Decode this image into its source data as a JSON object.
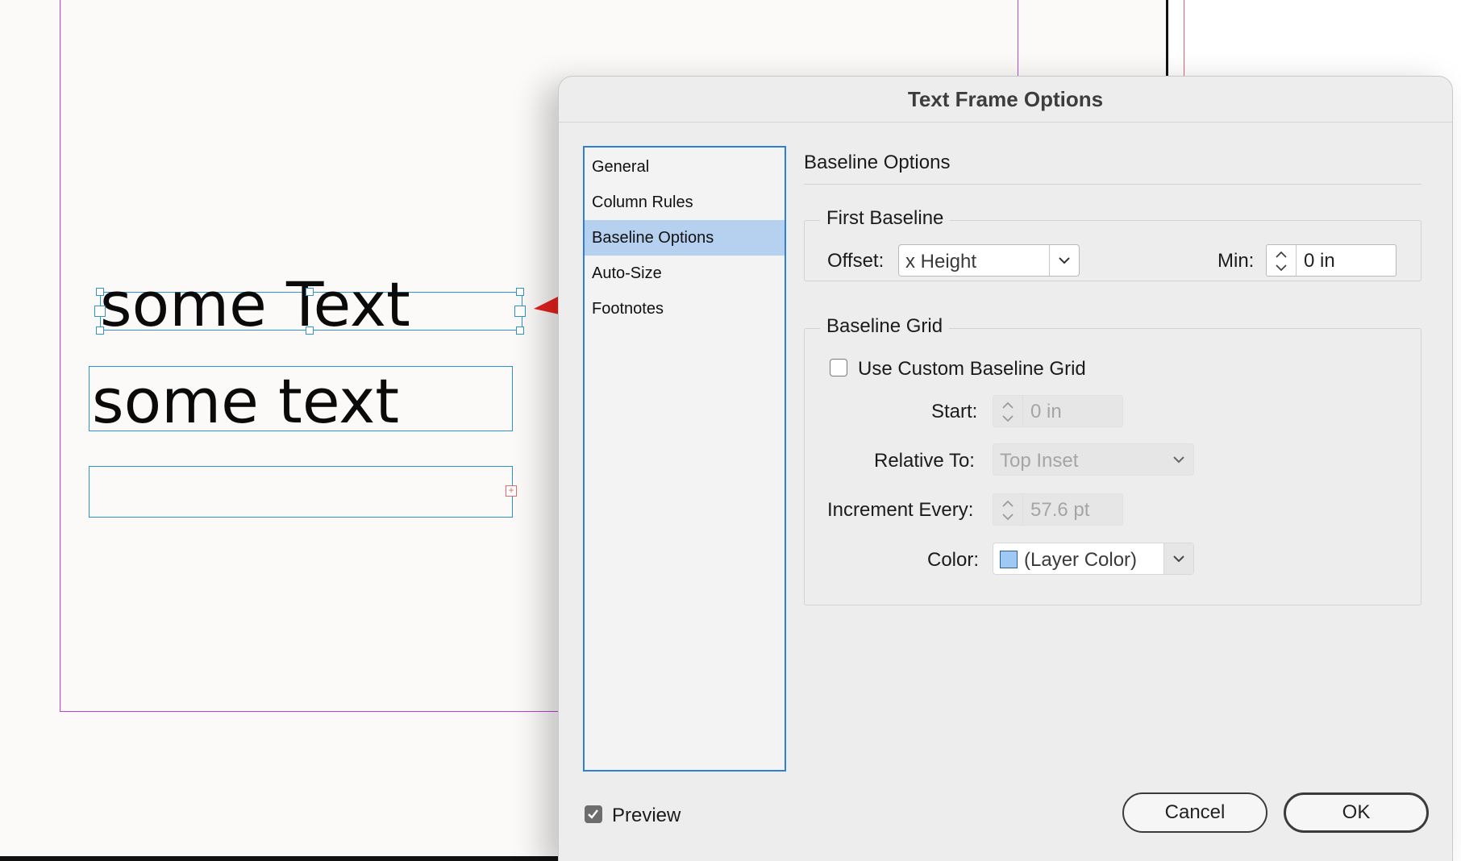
{
  "document": {
    "frames": [
      {
        "text": "some Text",
        "selected": true
      },
      {
        "text": "some text",
        "selected": false
      },
      {
        "text": "",
        "selected": false,
        "overset": true
      }
    ]
  },
  "dialog": {
    "title": "Text Frame Options",
    "sidebar": {
      "items": [
        {
          "label": "General",
          "selected": false
        },
        {
          "label": "Column Rules",
          "selected": false
        },
        {
          "label": "Baseline Options",
          "selected": true
        },
        {
          "label": "Auto-Size",
          "selected": false
        },
        {
          "label": "Footnotes",
          "selected": false
        }
      ]
    },
    "section_title": "Baseline Options",
    "first_baseline": {
      "legend": "First Baseline",
      "offset_label": "Offset:",
      "offset_value": "x Height",
      "min_label": "Min:",
      "min_value": "0 in"
    },
    "baseline_grid": {
      "legend": "Baseline Grid",
      "use_custom_label": "Use Custom Baseline Grid",
      "use_custom_checked": false,
      "start_label": "Start:",
      "start_value": "0 in",
      "relative_to_label": "Relative To:",
      "relative_to_value": "Top Inset",
      "increment_label": "Increment Every:",
      "increment_value": "57.6 pt",
      "color_label": "Color:",
      "color_value": "(Layer Color)",
      "swatch_color": "#9fc9f5"
    },
    "preview": {
      "label": "Preview",
      "checked": true
    },
    "cancel_label": "Cancel",
    "ok_label": "OK"
  },
  "annotation": {
    "arrow_color": "#e8221d",
    "icon": "red-arrow-annotation"
  }
}
